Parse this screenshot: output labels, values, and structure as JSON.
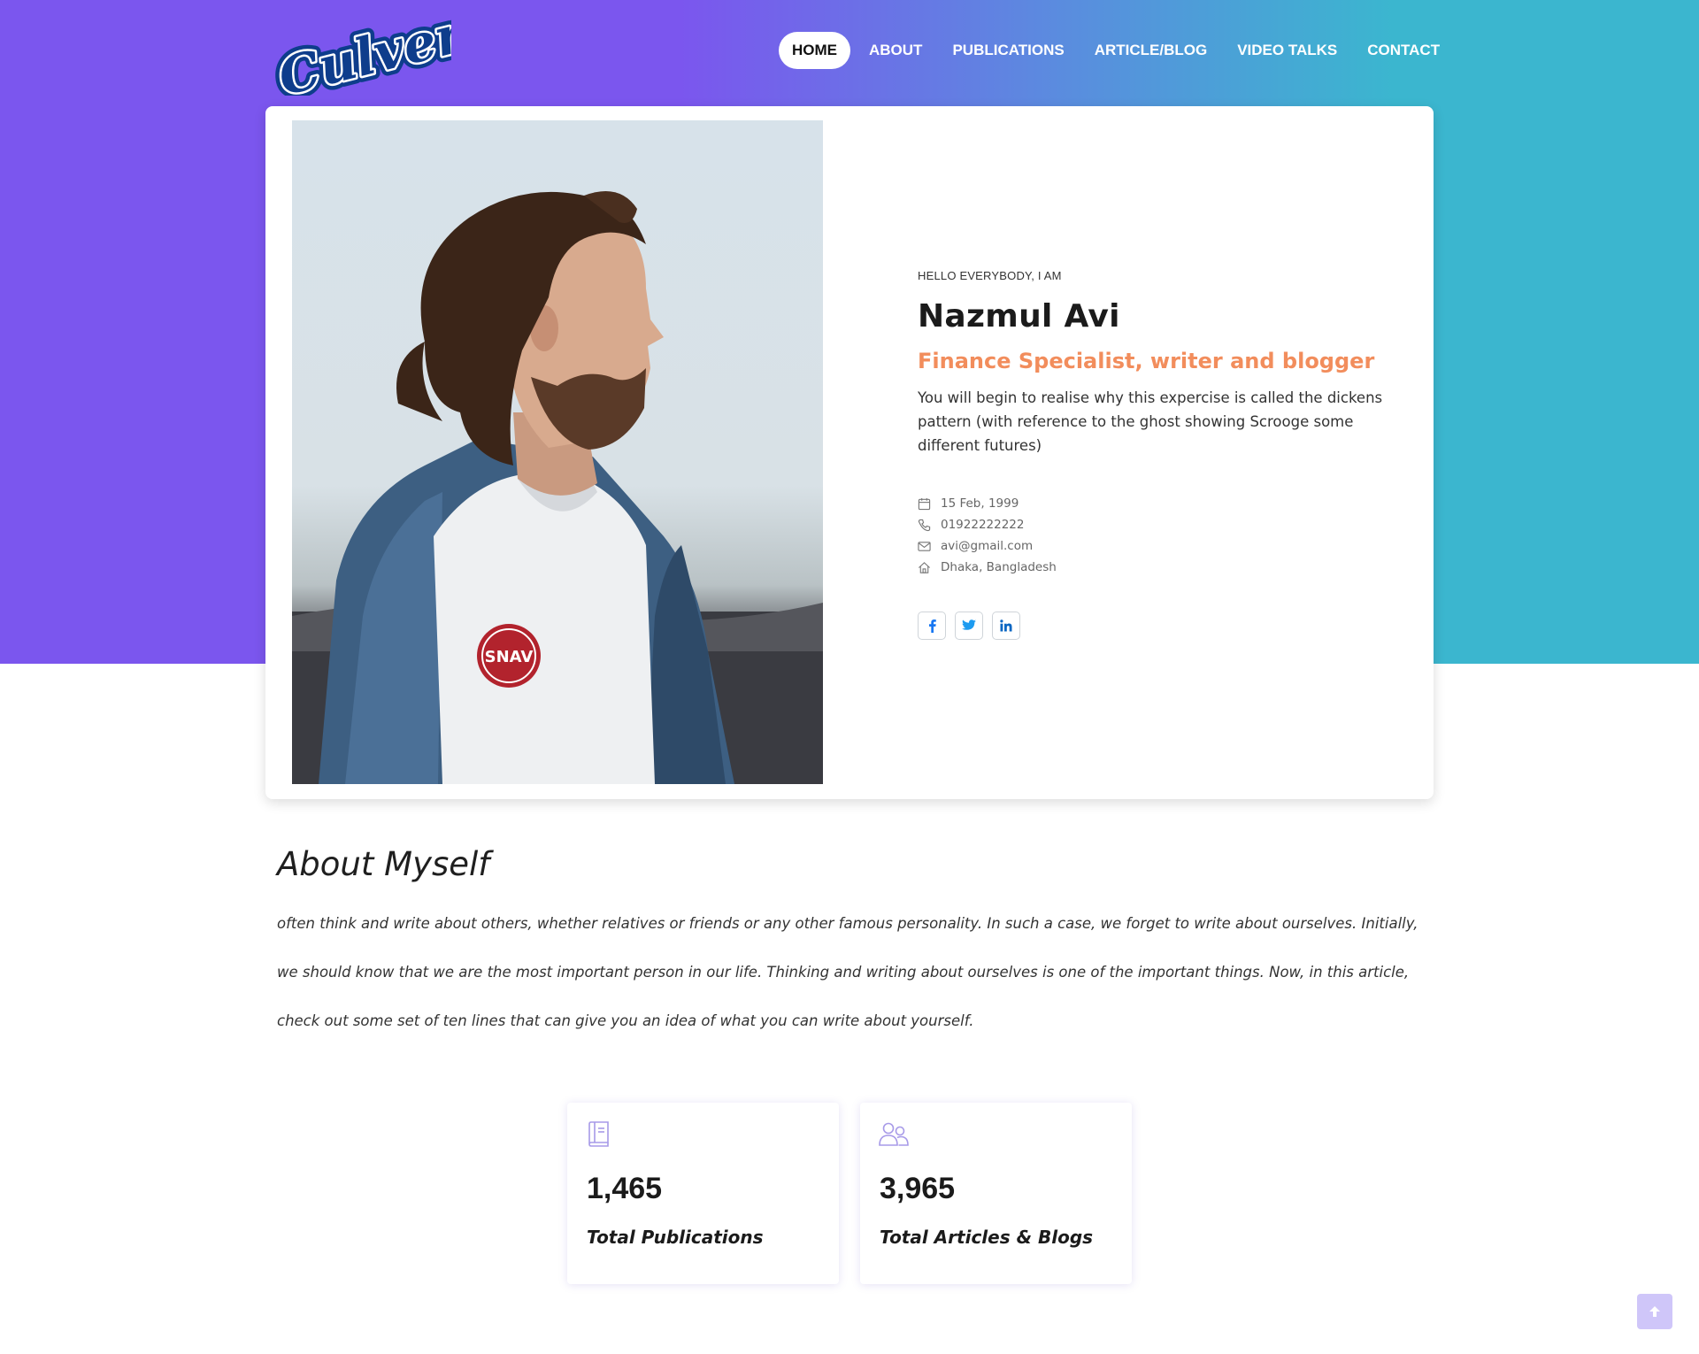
{
  "brand": {
    "logo_text": "Culver's"
  },
  "nav": {
    "items": [
      {
        "label": "HOME",
        "active": true
      },
      {
        "label": "ABOUT",
        "active": false
      },
      {
        "label": "PUBLICATIONS",
        "active": false
      },
      {
        "label": "ARTICLE/BLOG",
        "active": false
      },
      {
        "label": "VIDEO TALKS",
        "active": false
      },
      {
        "label": "CONTACT",
        "active": false
      }
    ]
  },
  "profile": {
    "greeting": "HELLO EVERYBODY, I AM",
    "name": "Nazmul Avi",
    "role": "Finance Specialist, writer and blogger",
    "bio": "You will begin to realise why this expercise is called the dickens pattern (with reference to the ghost showing Scrooge some different futures)",
    "details": {
      "birthday": "15 Feb, 1999",
      "phone": "01922222222",
      "email": "avi@gmail.com",
      "address": "Dhaka, Bangladesh"
    },
    "socials": [
      "facebook",
      "twitter",
      "linkedin"
    ]
  },
  "about": {
    "title": "About Myself",
    "text": "often think and write about others, whether relatives or friends or any other famous personality. In such a case, we forget to write about ourselves. Initially, we should know that we are the most important person in our life. Thinking and writing about ourselves is one of the important things. Now, in this article, check out some set of ten lines that can give you an idea of what you can write about yourself."
  },
  "stats": [
    {
      "icon": "book-icon",
      "value": "1,465",
      "label": "Total Publications"
    },
    {
      "icon": "users-icon",
      "value": "3,965",
      "label": "Total Articles & Blogs"
    }
  ],
  "colors": {
    "gradient_start": "#7b56ee",
    "gradient_end": "#3bb6cf",
    "accent": "#f28d5c",
    "icon_tint": "#9a8fe6"
  }
}
